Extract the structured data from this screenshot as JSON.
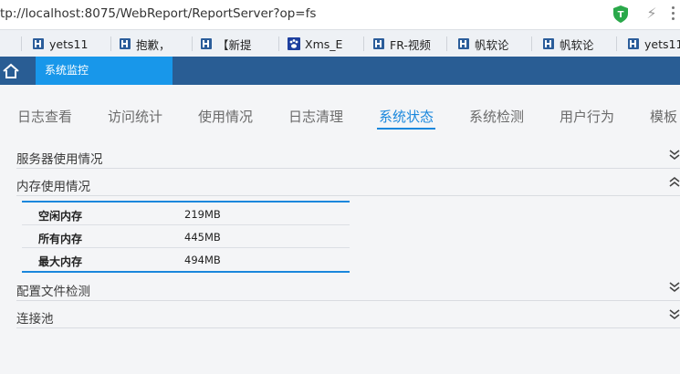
{
  "browser": {
    "url": "tp://localhost:8075/WebReport/ReportServer?op=fs",
    "extensions": [
      {
        "name": "shield-extension",
        "letter": "T",
        "color": "#2aa84a"
      },
      {
        "name": "bolt-extension"
      },
      {
        "name": "more-menu"
      }
    ]
  },
  "bookmarks": [
    {
      "label": "yets11",
      "icon": "fanruan-logo-icon"
    },
    {
      "label": "抱歉，",
      "icon": "fanruan-logo-icon"
    },
    {
      "label": "【新提",
      "icon": "fanruan-logo-icon"
    },
    {
      "label": "Xms_E",
      "icon": "paw-icon"
    },
    {
      "label": "FR-视频",
      "icon": "fanruan-logo-icon"
    },
    {
      "label": "帆软论",
      "icon": "fanruan-logo-icon"
    },
    {
      "label": "帆软论",
      "icon": "fanruan-logo-icon"
    },
    {
      "label": "yets11",
      "icon": "fanruan-logo-icon"
    }
  ],
  "app": {
    "tab_label": "系统监控",
    "colors": {
      "header": "#295d94",
      "active_tab": "#1897ea",
      "accent": "#1a87dc"
    }
  },
  "nav": {
    "tabs": [
      "日志查看",
      "访问统计",
      "使用情况",
      "日志清理",
      "系统状态",
      "系统检测",
      "用户行为",
      "模板"
    ],
    "active_index": 4
  },
  "sections": {
    "server_usage": {
      "title": "服务器使用情况",
      "expanded": false
    },
    "memory_usage": {
      "title": "内存使用情况",
      "expanded": true
    },
    "config_check": {
      "title": "配置文件检测",
      "expanded": false
    },
    "connection_pool": {
      "title": "连接池",
      "expanded": false
    }
  },
  "memory": [
    {
      "label": "空闲内存",
      "value": "219MB"
    },
    {
      "label": "所有内存",
      "value": "445MB"
    },
    {
      "label": "最大内存",
      "value": "494MB"
    }
  ]
}
